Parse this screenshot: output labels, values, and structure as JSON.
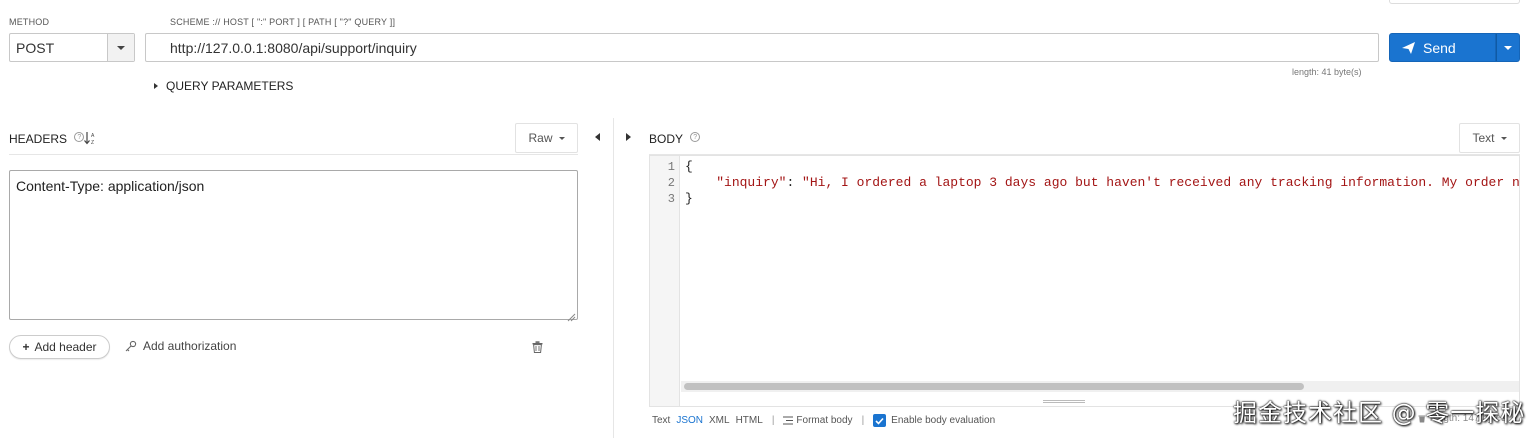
{
  "request": {
    "method_label": "METHOD",
    "method_value": "POST",
    "url_label": "SCHEME :// HOST [ \":\" PORT ] [ PATH [ \"?\" QUERY ]]",
    "url_value": "http://127.0.0.1:8080/api/support/inquiry",
    "url_length": "length: 41 byte(s)",
    "send_label": "Send",
    "query_params_label": "QUERY PARAMETERS"
  },
  "headers": {
    "title": "HEADERS",
    "mode": "Raw",
    "content": "Content-Type: application/json",
    "add_header_label": "Add header",
    "add_auth_label": "Add authorization"
  },
  "body": {
    "title": "BODY",
    "mode": "Text",
    "line_numbers": [
      "1",
      "2",
      "3"
    ],
    "line1": "{",
    "line2_key": "\"inquiry\"",
    "line2_colon": ": ",
    "line2_value": "\"Hi, I ordered a laptop 3 days ago but haven't received any tracking information. My order n",
    "line3": "}",
    "format_tabs": [
      "Text",
      "JSON",
      "XML",
      "HTML"
    ],
    "active_format": "JSON",
    "format_body_label": "Format body",
    "enable_eval_label": "Enable body evaluation",
    "length_label": "length: 147 bytes"
  },
  "watermark": "掘金技术社区 @ 零一探秘",
  "colors": {
    "accent": "#1a74d0",
    "string": "#a31515"
  }
}
